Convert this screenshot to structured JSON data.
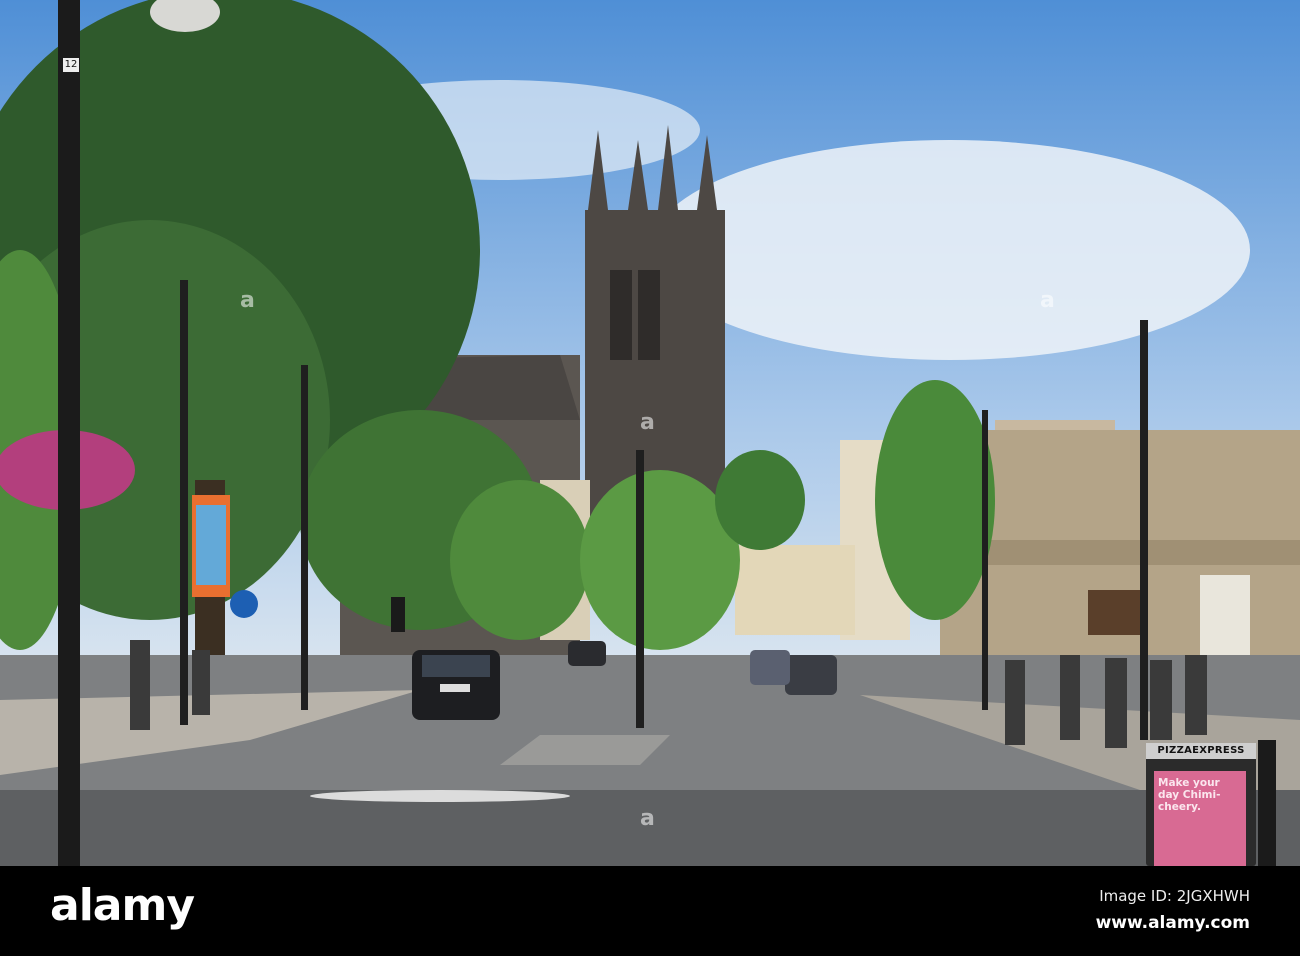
{
  "photo": {
    "lamp_post_number": "12",
    "sign": {
      "brand": "PIZZAEXPRESS",
      "headline": "Make your day Chimi-cheery."
    }
  },
  "watermark": {
    "logo": "alamy",
    "image_id": "Image ID: 2JGXHWH",
    "website": "www.alamy.com",
    "overlay_mark": "a"
  }
}
